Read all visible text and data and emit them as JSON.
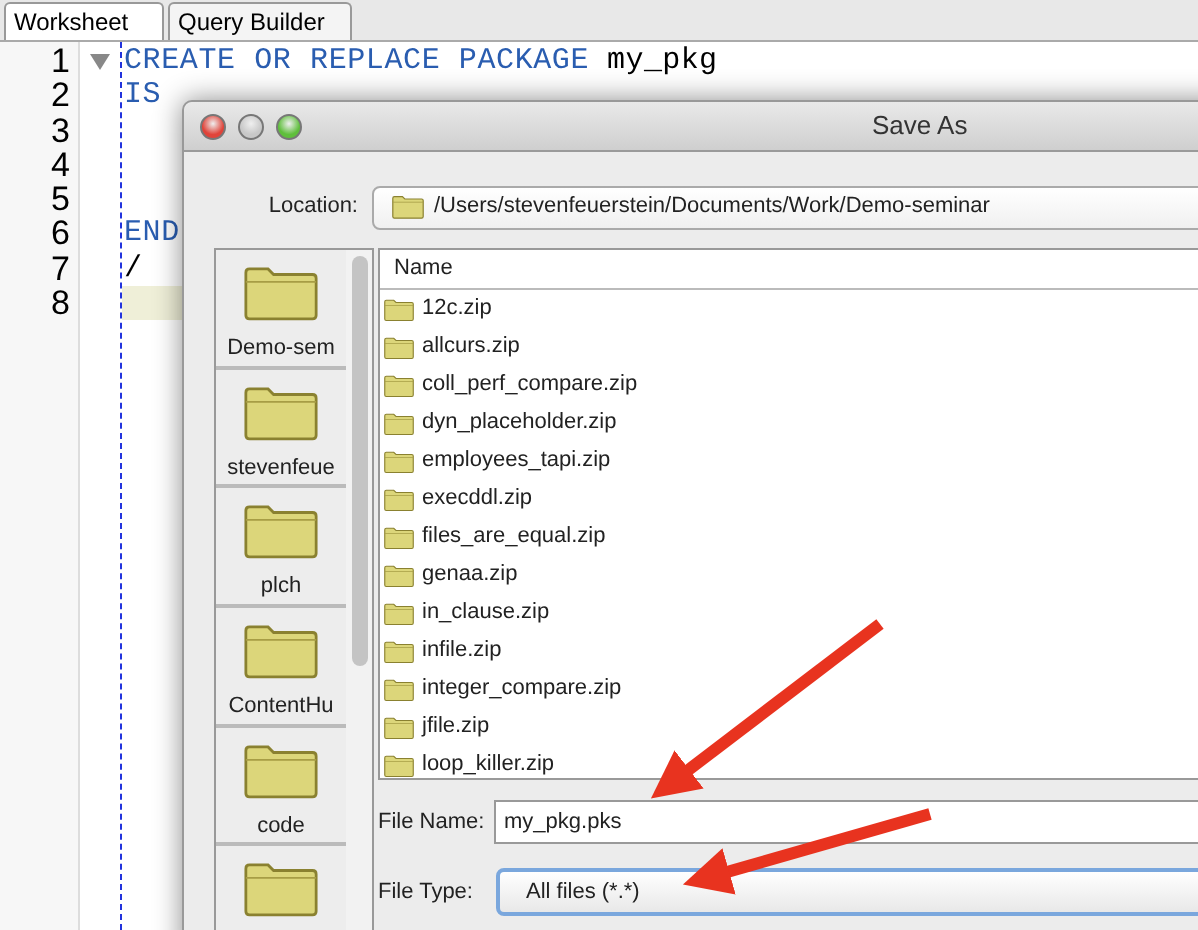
{
  "tabs": [
    {
      "label": "Worksheet",
      "selected": true
    },
    {
      "label": "Query Builder",
      "selected": false
    }
  ],
  "editor": {
    "lines": [
      {
        "number": "1",
        "tokens": [
          {
            "kind": "keyword",
            "text": "CREATE OR REPLACE PACKAGE"
          },
          {
            "kind": "identifier",
            "text": "my_pkg"
          }
        ],
        "current": false
      },
      {
        "number": "2",
        "tokens": [
          {
            "kind": "keyword",
            "text": "IS"
          }
        ],
        "current": false
      },
      {
        "number": "3",
        "current": false
      },
      {
        "number": "4",
        "current": false
      },
      {
        "number": "5",
        "current": false
      },
      {
        "number": "6",
        "tokens": [
          {
            "kind": "keyword",
            "text": "END"
          }
        ],
        "current": false
      },
      {
        "number": "7",
        "tokens": [
          {
            "kind": "identifier",
            "text": "/"
          }
        ],
        "current": false
      },
      {
        "number": "8",
        "current": true
      }
    ]
  },
  "dialog": {
    "title": "Save As",
    "location_label": "Location:",
    "location": "/Users/stevenfeuerstein/Documents/Work/Demo-seminar",
    "places": [
      {
        "kind": "folder",
        "label": "Demo-sem"
      },
      {
        "kind": "folder",
        "label": "stevenfeue"
      },
      {
        "kind": "folder",
        "label": "plch"
      },
      {
        "kind": "folder",
        "label": "ContentHu"
      },
      {
        "kind": "folder",
        "label": "code"
      },
      {
        "kind": "folder"
      }
    ],
    "column_header": "Name",
    "files": [
      "12c.zip",
      "allcurs.zip",
      "coll_perf_compare.zip",
      "dyn_placeholder.zip",
      "employees_tapi.zip",
      "execddl.zip",
      "files_are_equal.zip",
      "genaa.zip",
      "in_clause.zip",
      "infile.zip",
      "integer_compare.zip",
      "jfile.zip",
      "loop_killer.zip"
    ],
    "file_name_label": "File Name:",
    "file_name": "my_pkg.pks",
    "file_type_label": "File Type:",
    "file_type": "All files (*.*)"
  }
}
